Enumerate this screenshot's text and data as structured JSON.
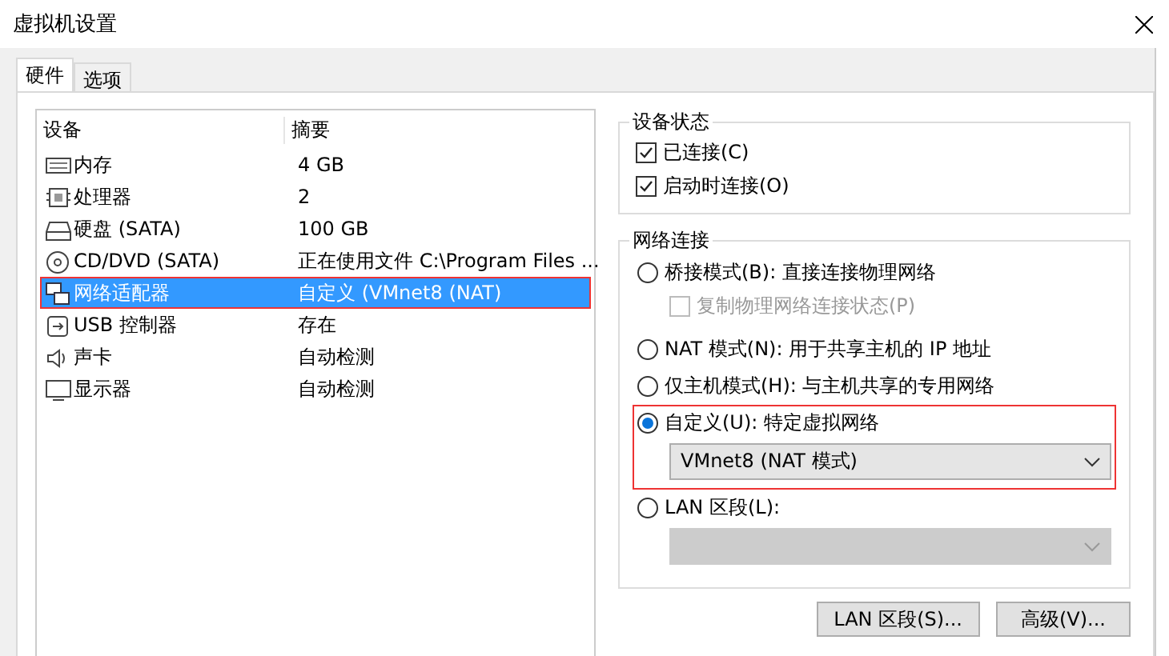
{
  "window": {
    "title": "虚拟机设置"
  },
  "tabs": [
    {
      "label": "硬件",
      "selected": true
    },
    {
      "label": "选项",
      "selected": false
    }
  ],
  "devices": {
    "columns": [
      "设备",
      "摘要"
    ],
    "rows": [
      {
        "name": "内存",
        "summary": "4 GB",
        "selected": false
      },
      {
        "name": "处理器",
        "summary": "2",
        "selected": false
      },
      {
        "name": "硬盘 (SATA)",
        "summary": "100 GB",
        "selected": false
      },
      {
        "name": "CD/DVD (SATA)",
        "summary": "正在使用文件 C:\\Program Files ...",
        "selected": false
      },
      {
        "name": "网络适配器",
        "summary": "自定义 (VMnet8 (NAT)",
        "selected": true
      },
      {
        "name": "USB 控制器",
        "summary": "存在",
        "selected": false
      },
      {
        "name": "声卡",
        "summary": "自动检测",
        "selected": false
      },
      {
        "name": "显示器",
        "summary": "自动检测",
        "selected": false
      }
    ]
  },
  "device_status": {
    "title": "设备状态",
    "checkboxes": [
      {
        "label": "已连接(C)",
        "checked": true
      },
      {
        "label": "启动时连接(O)",
        "checked": true
      }
    ]
  },
  "network": {
    "title": "网络连接",
    "options": [
      {
        "label": "桥接模式(B): 直接连接物理网络",
        "selected": false,
        "checkbox": {
          "label": "复制物理网络连接状态(P)",
          "checked": false,
          "disabled": true
        }
      },
      {
        "label": "NAT 模式(N): 用于共享主机的 IP 地址",
        "selected": false
      },
      {
        "label": "仅主机模式(H): 与主机共享的专用网络",
        "selected": false
      },
      {
        "label": "自定义(U): 特定虚拟网络",
        "selected": true,
        "dropdown": {
          "value": "VMnet8 (NAT 模式)",
          "disabled": false
        }
      },
      {
        "label": "LAN 区段(L):",
        "selected": false,
        "dropdown": {
          "disabled": true
        }
      }
    ]
  },
  "buttons": [
    "LAN 区段(S)...",
    "高级(V)..."
  ]
}
